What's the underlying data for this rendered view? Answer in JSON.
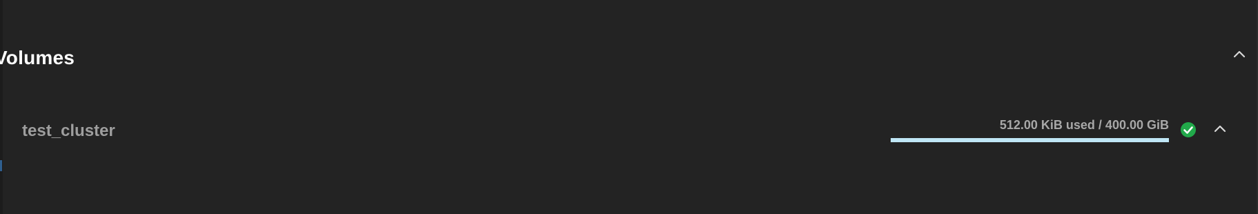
{
  "section": {
    "title": "Volumes",
    "collapse_icon": "chevron-up-icon"
  },
  "volumes": [
    {
      "name": "test_cluster",
      "usage_label": "512.00 KiB used / 400.00 GiB",
      "used_fraction": 1.2e-06,
      "status": "healthy",
      "status_icon": "check-circle-icon",
      "status_color": "#21a94a",
      "collapse_icon": "chevron-up-icon"
    }
  ],
  "colors": {
    "background": "#232323",
    "title": "#ffffff",
    "volume_name": "#9e9e9e",
    "usage_text": "#a8a8a8",
    "usage_bar_track": "#bfe6f5",
    "usage_bar_fill": "#3aa7d6",
    "status_ok": "#21a94a"
  }
}
